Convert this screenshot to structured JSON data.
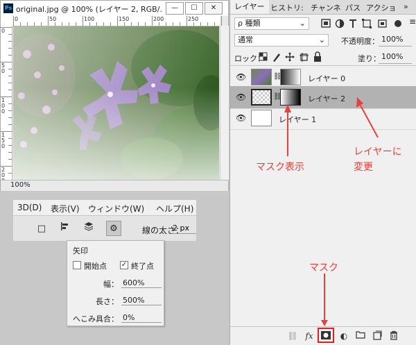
{
  "document": {
    "title": "original.jpg @ 100% (レイヤー 2, RGB/...",
    "app_icon": "Ps",
    "zoom": "100%",
    "ruler_top_labels": [
      "0",
      "50",
      "100",
      "150",
      "200",
      "250"
    ],
    "ruler_left_labels": [
      "0",
      "5\n0",
      "1\n0\n0",
      "1\n5\n0",
      "2\n0\n0"
    ]
  },
  "window_buttons": {
    "minimize": "—",
    "maximize": "☐",
    "close": "✕"
  },
  "menubar": {
    "items": [
      "3D(D)",
      "表示(V)",
      "ウィンドウ(W)",
      "ヘルプ(H)"
    ]
  },
  "options": {
    "stroke_label": "線の太さ：",
    "stroke_value": "2 px"
  },
  "arrow_popup": {
    "title": "矢印",
    "start_label": "開始点",
    "start_checked": false,
    "end_label": "終了点",
    "end_checked": true,
    "width_label": "幅：",
    "width_value": "600%",
    "length_label": "長さ：",
    "length_value": "500%",
    "concavity_label": "へこみ具合：",
    "concavity_value": "0%"
  },
  "panel": {
    "tabs": [
      "レイヤー",
      "ヒストリ:",
      "チャンネ",
      "パス",
      "アクショ"
    ],
    "menu_icon": "≡",
    "collapse_icon": "»",
    "filter_label": "ρ 種類",
    "blend_mode": "通常",
    "opacity_label": "不透明度：",
    "opacity_value": "100%",
    "lock_label": "ロック：",
    "fill_label": "塗り：",
    "fill_value": "100%",
    "layers": [
      {
        "name": "レイヤー 0",
        "has_mask": true,
        "selected": false
      },
      {
        "name": "レイヤー 2",
        "has_mask": true,
        "selected": true
      },
      {
        "name": "レイヤー 1",
        "has_mask": false,
        "selected": false
      }
    ],
    "bottom_icons": [
      "link-icon",
      "fx-icon",
      "add-mask-icon",
      "adjustment-icon",
      "folder-icon",
      "new-layer-icon",
      "trash-icon"
    ],
    "fx_label": "fx"
  },
  "annotations": {
    "mask_display": "マスク表示",
    "change_to_layer_line1": "レイヤーに",
    "change_to_layer_line2": "変更",
    "mask": "マスク"
  },
  "colors": {
    "annotation": "#e8403a",
    "selected_row": "#b2b2b2",
    "highlight_box": "#e02020"
  }
}
